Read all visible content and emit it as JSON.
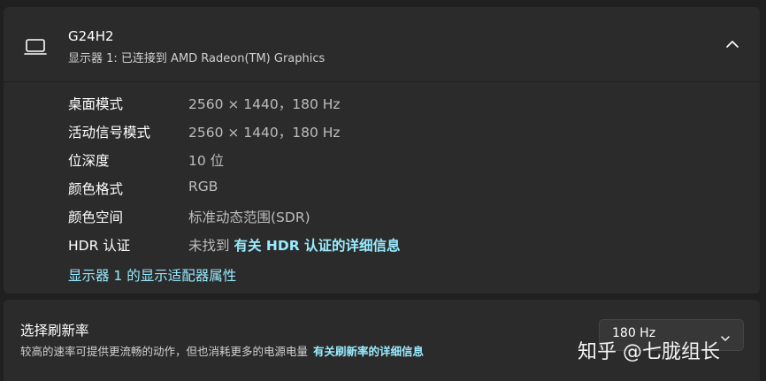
{
  "display": {
    "name": "G24H2",
    "subtitle": "显示器 1: 已连接到 AMD Radeon(TM) Graphics"
  },
  "info_rows": [
    {
      "label": "桌面模式",
      "value": "2560 × 1440，180 Hz"
    },
    {
      "label": "活动信号模式",
      "value": "2560 × 1440，180 Hz"
    },
    {
      "label": "位深度",
      "value": "10 位"
    },
    {
      "label": "颜色格式",
      "value": "RGB"
    },
    {
      "label": "颜色空间",
      "value": "标准动态范围(SDR)"
    }
  ],
  "hdr": {
    "label": "HDR 认证",
    "value": "未找到",
    "link": "有关 HDR 认证的详细信息"
  },
  "adapter_link": "显示器 1 的显示适配器属性",
  "refresh": {
    "title": "选择刷新率",
    "description": "较高的速率可提供更流畅的动作，但也消耗更多的电源电量",
    "link": "有关刷新率的详细信息",
    "selected": "180 Hz"
  },
  "watermark": "知乎 @七胧组长",
  "colors": {
    "background": "#202020",
    "card": "#2b2b2b",
    "link": "#99ebff",
    "secondary_text": "#bdbdbd"
  },
  "icons": {
    "display": "monitor-icon",
    "collapse": "chevron-up-icon",
    "dropdown": "chevron-down-icon"
  }
}
